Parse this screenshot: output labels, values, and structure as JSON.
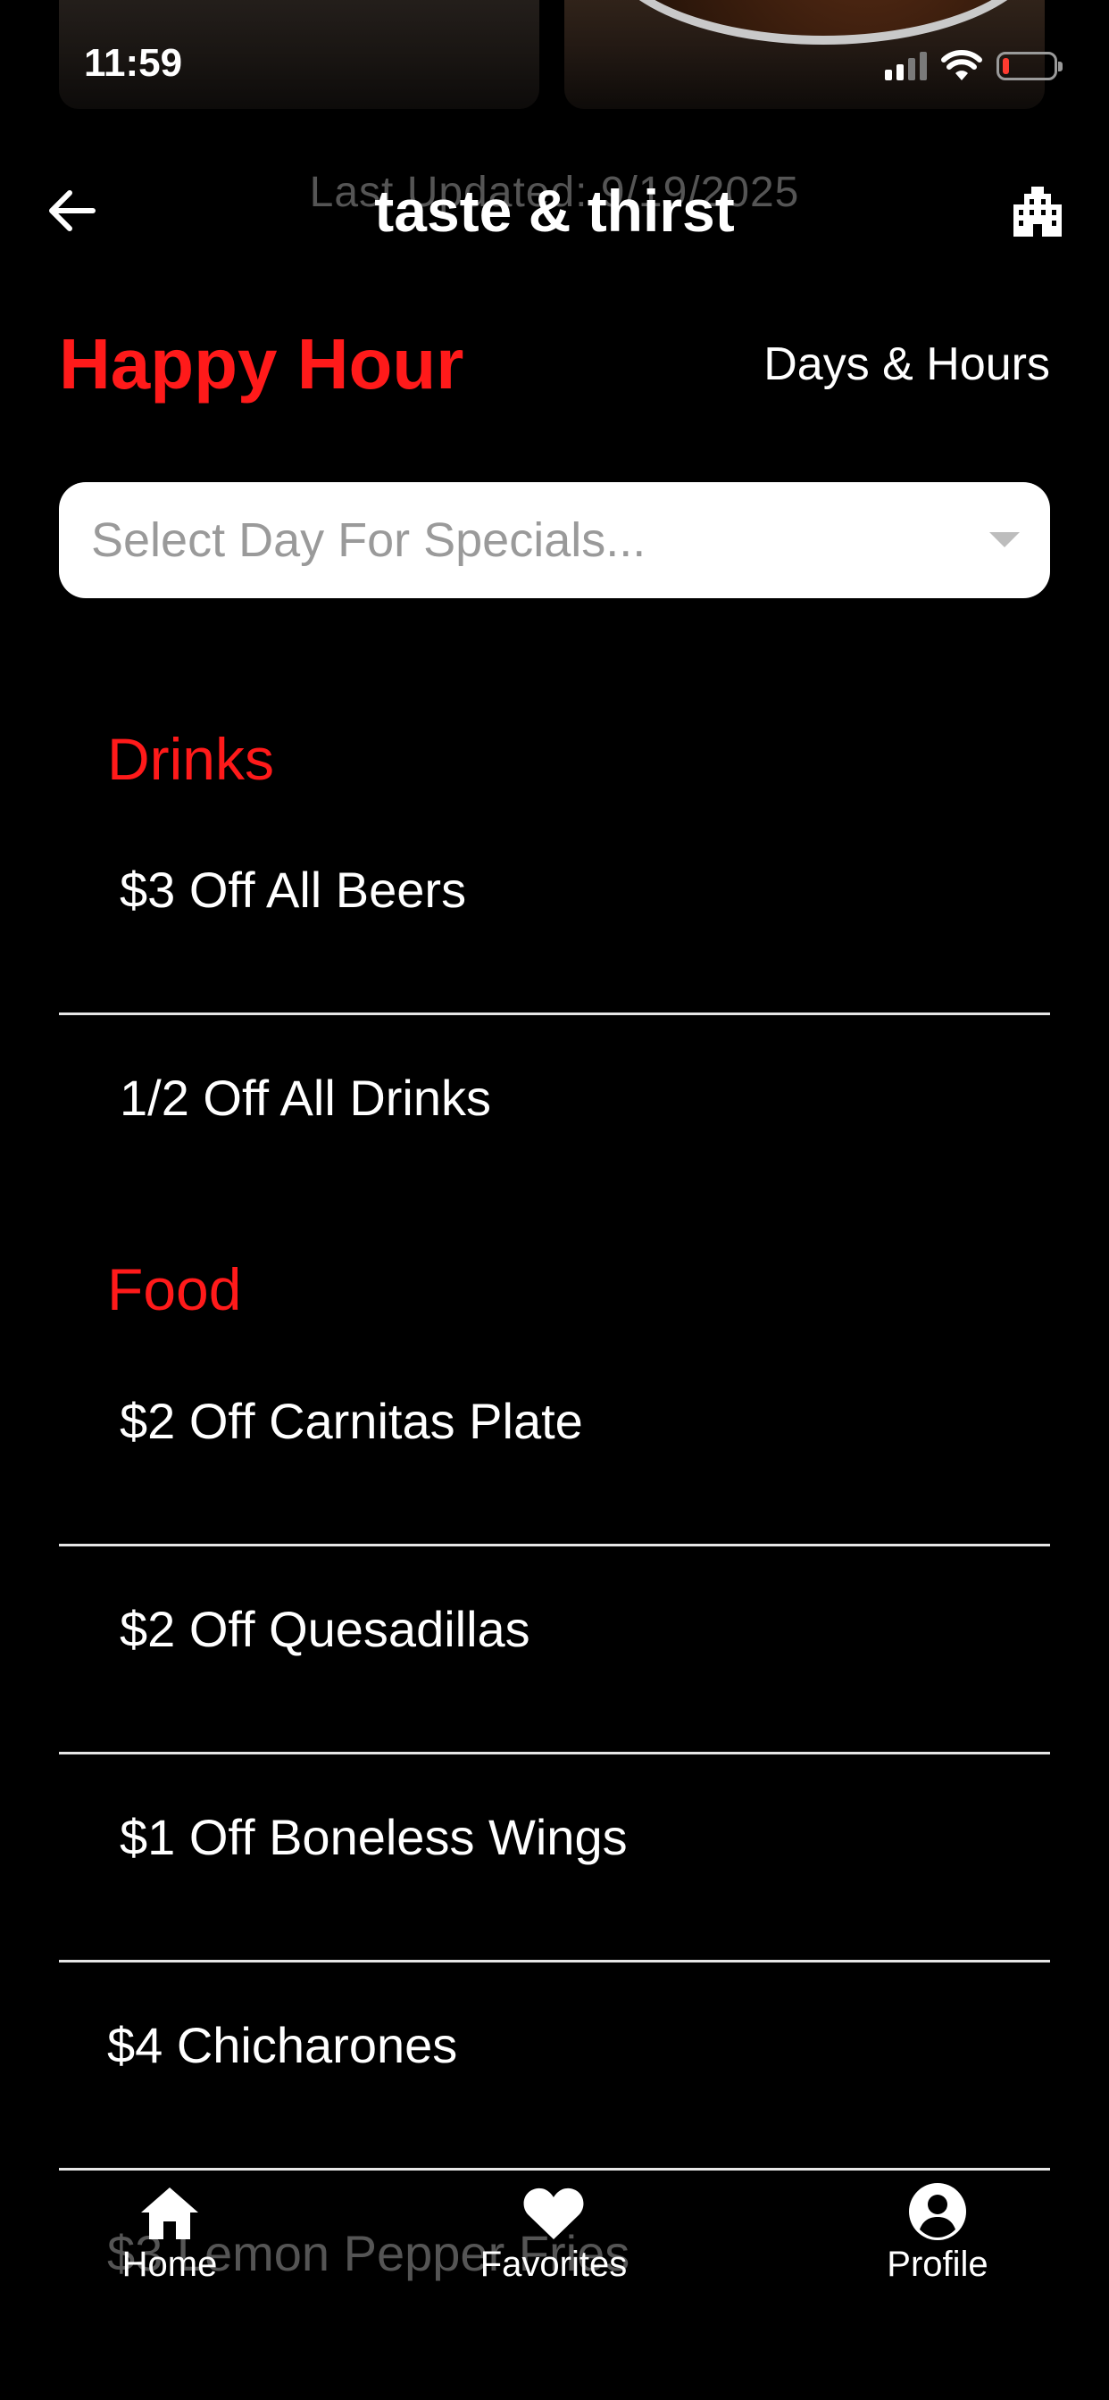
{
  "status_bar": {
    "time": "11:59",
    "battery_color": "#ff3b30"
  },
  "header": {
    "back_icon": "arrow-left-icon",
    "last_updated": "Last Updated: 9/19/2025",
    "title": "taste & thirst",
    "venue_icon": "building-icon"
  },
  "happy_hour": {
    "title": "Happy Hour",
    "days_hours_label": "Days & Hours",
    "accent_color": "#ff1a1a"
  },
  "day_select": {
    "placeholder": "Select Day For Specials...",
    "icon": "chevron-down-icon"
  },
  "categories": [
    {
      "name": "Drinks",
      "items": [
        "$3 Off All Beers",
        "1/2 Off All Drinks"
      ]
    },
    {
      "name": "Food",
      "items": [
        "$2 Off Carnitas Plate",
        "$2 Off Quesadillas",
        "$1 Off Boneless Wings",
        "$4 Chicharones",
        "$3 Lemon Pepper Fries"
      ]
    }
  ],
  "bottom_nav": {
    "items": [
      {
        "label": "Home",
        "icon": "home-icon"
      },
      {
        "label": "Favorites",
        "icon": "heart-icon"
      },
      {
        "label": "Profile",
        "icon": "user-circle-icon"
      }
    ]
  }
}
